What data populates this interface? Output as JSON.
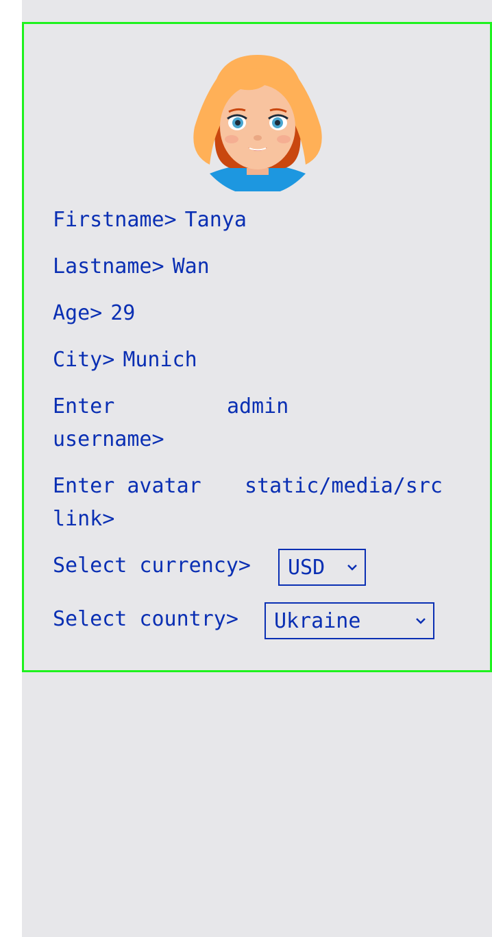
{
  "profile": {
    "firstname_label": "Firstname>",
    "firstname_value": "Tanya",
    "lastname_label": "Lastname>",
    "lastname_value": "Wan",
    "age_label": "Age>",
    "age_value": "29",
    "city_label": "City>",
    "city_value": "Munich",
    "username_label_line1": "Enter",
    "username_label_line2": "username>",
    "username_value": "admin",
    "avatar_label_line1": "Enter avatar",
    "avatar_label_line2": "link>",
    "avatar_value": "static/media/src",
    "currency_label": "Select currency>",
    "currency_selected": "USD",
    "country_label": "Select country>",
    "country_selected": "Ukraine"
  },
  "icons": {
    "avatar": "avatar-girl-icon",
    "chevron": "chevron-down-icon"
  },
  "colors": {
    "text": "#0a2fb3",
    "card_border": "#1ef21e",
    "background": "#e7e7ea"
  }
}
